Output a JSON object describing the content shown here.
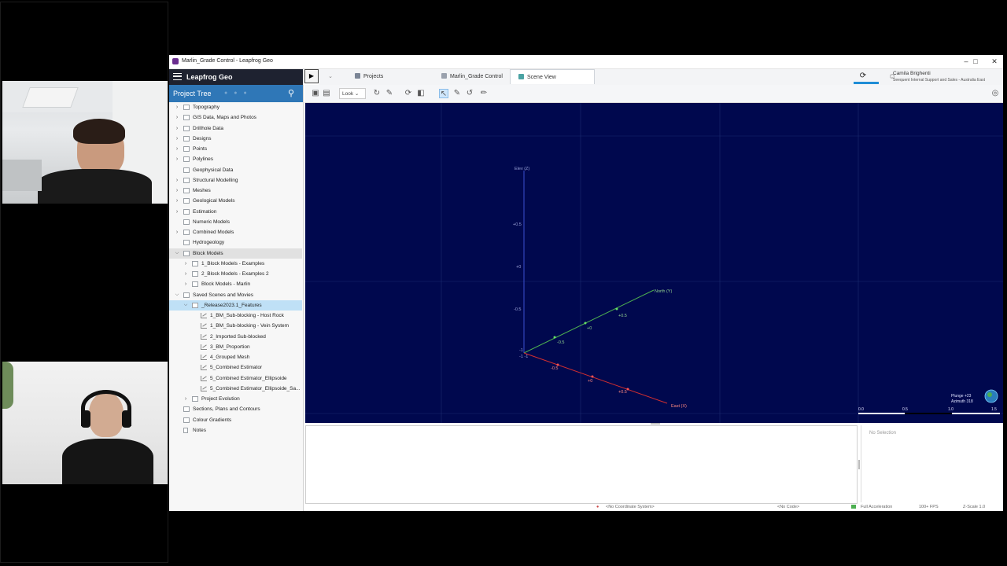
{
  "window": {
    "title": "Marlin_Grade Control - Leapfrog Geo"
  },
  "app": {
    "name": "Leapfrog Geo"
  },
  "tabs": [
    {
      "label": "Projects"
    },
    {
      "label": "Marlin_Grade Control"
    },
    {
      "label": "Scene View"
    }
  ],
  "user": {
    "name": "Camila Brighenti",
    "org": "Seequent Internal Support and Sales - Australia East"
  },
  "project_tree": {
    "header": "Project Tree",
    "items": [
      {
        "label": "Topography"
      },
      {
        "label": "GIS Data, Maps and Photos"
      },
      {
        "label": "Drillhole Data"
      },
      {
        "label": "Designs"
      },
      {
        "label": "Points"
      },
      {
        "label": "Polylines"
      },
      {
        "label": "Geophysical Data"
      },
      {
        "label": "Structural Modelling"
      },
      {
        "label": "Meshes"
      },
      {
        "label": "Geological Models"
      },
      {
        "label": "Estimation"
      },
      {
        "label": "Numeric Models"
      },
      {
        "label": "Combined Models"
      },
      {
        "label": "Hydrogeology"
      },
      {
        "label": "Block Models"
      },
      {
        "label": "1_Block Models - Examples"
      },
      {
        "label": "2_Block Models - Examples 2"
      },
      {
        "label": "Block Models - Marlin"
      },
      {
        "label": "Saved Scenes and Movies"
      },
      {
        "label": "_Release2023.1_Features"
      },
      {
        "label": "1_BM_Sub-blocking - Host Rock"
      },
      {
        "label": "1_BM_Sub-blocking - Vein System"
      },
      {
        "label": "2_Imported Sub-blocked"
      },
      {
        "label": "3_BM_Proportion"
      },
      {
        "label": "4_Grouped Mesh"
      },
      {
        "label": "5_Combined Estimator"
      },
      {
        "label": "5_Combined Estimator_Ellipsoide"
      },
      {
        "label": "5_Combined Estimator_Ellipsoide_Sa..."
      },
      {
        "label": "Project Evolution"
      },
      {
        "label": "Sections, Plans and Contours"
      },
      {
        "label": "Colour Gradients"
      },
      {
        "label": "Notes"
      }
    ]
  },
  "toolbar": {
    "look_label": "Look"
  },
  "scene": {
    "axis_elev": "Elev (Z)",
    "axis_north": "North (Y)",
    "axis_east": "East (X)",
    "ticks_z": [
      "+0.5",
      "+0",
      "-0.5"
    ],
    "ticks_y": [
      "-0.5",
      "+0",
      "+0.5"
    ],
    "ticks_x": [
      "-0.5",
      "+0",
      "+0.5"
    ],
    "origin_labels": [
      "-1",
      "-1 -1"
    ],
    "plunge": "Plunge +23",
    "azimuth": "Azimuth 318",
    "scale_ticks": [
      "0.0",
      "0.5",
      "1.0",
      "1.5"
    ],
    "colors": {
      "background": "#00084e",
      "north_axis": "#4caf50",
      "east_axis": "#d32f2f",
      "elev_axis": "#3f51b5"
    }
  },
  "selection": {
    "empty_label": "No Selection"
  },
  "status": {
    "coord": "<No Coordinate System>",
    "code": "<No Code>",
    "accel": "Full Acceleration",
    "fps": "100+ FPS",
    "zscale": "Z-Scale 1.0"
  }
}
